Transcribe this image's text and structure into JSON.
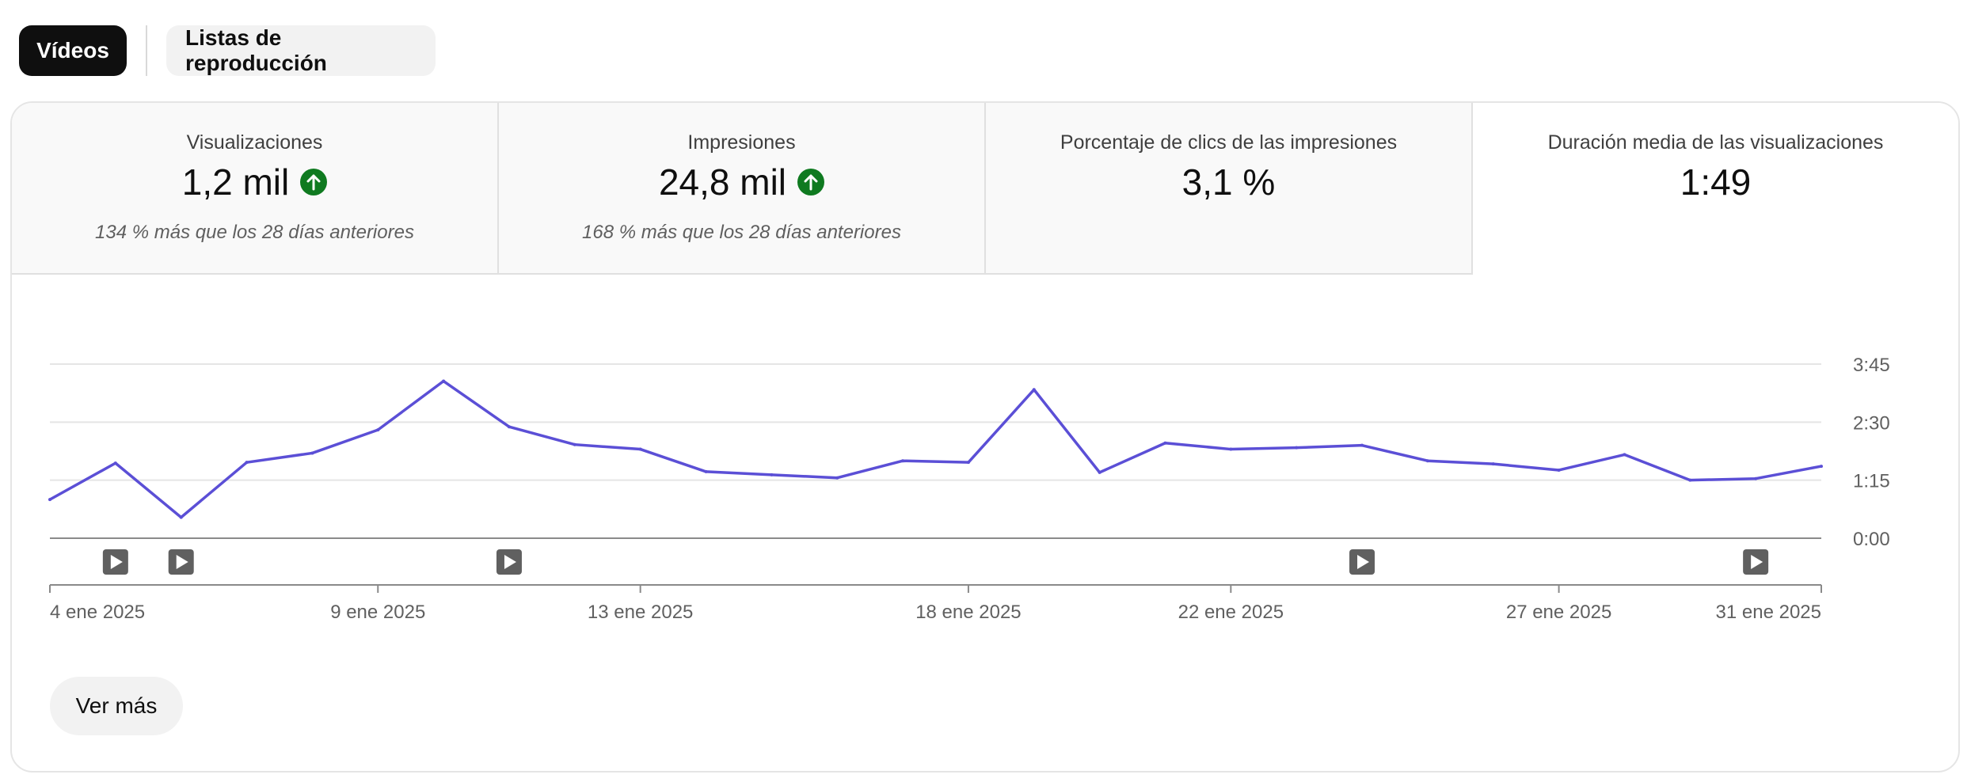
{
  "tabs": {
    "videos": "Vídeos",
    "playlists": "Listas de reproducción"
  },
  "metrics": [
    {
      "label": "Visualizaciones",
      "value": "1,2 mil",
      "trend": "up",
      "comparison": "134 % más que los 28 días anteriores"
    },
    {
      "label": "Impresiones",
      "value": "24,8 mil",
      "trend": "up",
      "comparison": "168 % más que los 28 días anteriores"
    },
    {
      "label": "Porcentaje de clics de las impresiones",
      "value": "3,1 %",
      "trend": "",
      "comparison": ""
    },
    {
      "label": "Duración media de las visualizaciones",
      "value": "1:49",
      "trend": "",
      "comparison": ""
    }
  ],
  "colors": {
    "line": "#5b4fd6",
    "trend_up": "#0f7a20",
    "grid": "#e5e5e5",
    "axis": "#606060"
  },
  "icons": {
    "trend": "arrow-up-circle-icon",
    "video_marker": "play-icon"
  },
  "chart_data": {
    "type": "line",
    "x_tick_labels": [
      "4 ene 2025",
      "9 ene 2025",
      "13 ene 2025",
      "18 ene 2025",
      "22 ene 2025",
      "27 ene 2025",
      "31 ene 2025"
    ],
    "y_tick_labels": [
      "0:00",
      "1:15",
      "2:30",
      "3:45"
    ],
    "ylim_seconds": [
      0,
      225
    ],
    "series": [
      {
        "dates": [
          "4 ene",
          "5 ene",
          "6 ene",
          "7 ene",
          "8 ene",
          "9 ene",
          "10 ene",
          "11 ene",
          "12 ene",
          "13 ene",
          "14 ene",
          "15 ene",
          "16 ene",
          "17 ene",
          "18 ene",
          "19 ene",
          "20 ene",
          "21 ene",
          "22 ene",
          "23 ene",
          "24 ene",
          "25 ene",
          "26 ene",
          "27 ene",
          "28 ene",
          "29 ene",
          "30 ene",
          "31 ene"
        ],
        "values_seconds": [
          50,
          97,
          27,
          98,
          110,
          140,
          203,
          144,
          121,
          115,
          86,
          82,
          78,
          100,
          98,
          192,
          85,
          123,
          115,
          117,
          120,
          100,
          96,
          88,
          108,
          75,
          77,
          93
        ]
      }
    ],
    "video_markers": [
      "5 ene",
      "6 ene",
      "11 ene",
      "24 ene",
      "30 ene"
    ],
    "grid": true
  },
  "see_more": "Ver más"
}
